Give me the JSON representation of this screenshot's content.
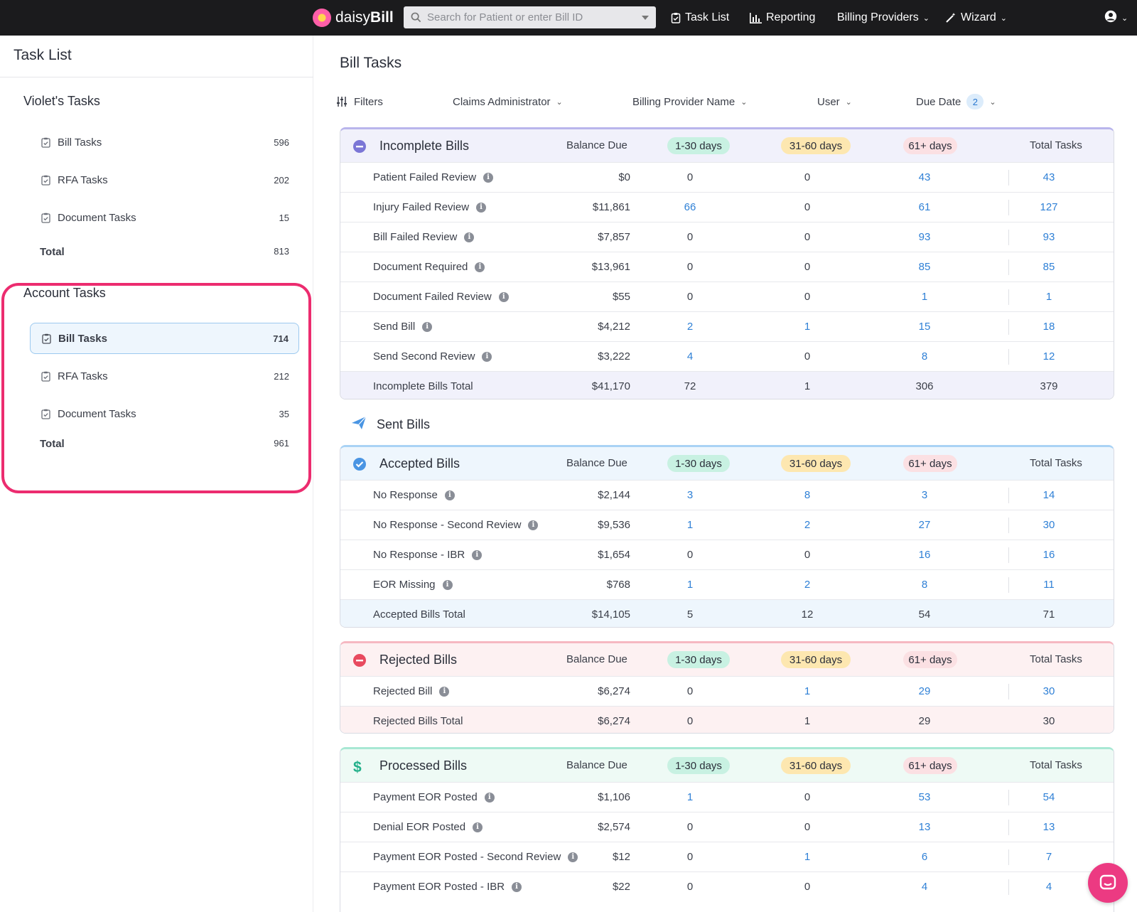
{
  "topbar": {
    "logo_daisy": "daisy",
    "logo_bill": "Bill",
    "search_placeholder": "Search for Patient or enter Bill ID",
    "nav": {
      "task_list": "Task List",
      "reporting": "Reporting",
      "billing_providers": "Billing Providers",
      "wizard": "Wizard"
    }
  },
  "sidebar": {
    "title": "Task List",
    "violet": {
      "title": "Violet's Tasks",
      "items": [
        {
          "label": "Bill Tasks",
          "count": "596"
        },
        {
          "label": "RFA Tasks",
          "count": "202"
        },
        {
          "label": "Document Tasks",
          "count": "15"
        }
      ],
      "total_label": "Total",
      "total_count": "813"
    },
    "account": {
      "title": "Account Tasks",
      "items": [
        {
          "label": "Bill Tasks",
          "count": "714"
        },
        {
          "label": "RFA Tasks",
          "count": "212"
        },
        {
          "label": "Document Tasks",
          "count": "35"
        }
      ],
      "total_label": "Total",
      "total_count": "961"
    }
  },
  "main": {
    "title": "Bill Tasks",
    "filters": {
      "label": "Filters",
      "claims_admin": "Claims Administrator",
      "billing_provider": "Billing Provider Name",
      "user": "User",
      "due_date": "Due Date",
      "due_date_count": "2"
    },
    "columns": {
      "balance": "Balance Due",
      "d1": "1-30 days",
      "d2": "31-60 days",
      "d3": "61+ days",
      "total": "Total Tasks"
    },
    "sent_bills_label": "Sent Bills",
    "sections": {
      "incomplete": {
        "title": "Incomplete Bills",
        "rows": [
          {
            "label": "Patient Failed Review",
            "balance": "$0",
            "d1": "0",
            "d2": "0",
            "d3": "43",
            "total": "43"
          },
          {
            "label": "Injury Failed Review",
            "balance": "$11,861",
            "d1": "66",
            "d2": "0",
            "d3": "61",
            "total": "127"
          },
          {
            "label": "Bill Failed Review",
            "balance": "$7,857",
            "d1": "0",
            "d2": "0",
            "d3": "93",
            "total": "93"
          },
          {
            "label": "Document Required",
            "balance": "$13,961",
            "d1": "0",
            "d2": "0",
            "d3": "85",
            "total": "85"
          },
          {
            "label": "Document Failed Review",
            "balance": "$55",
            "d1": "0",
            "d2": "0",
            "d3": "1",
            "total": "1"
          },
          {
            "label": "Send Bill",
            "balance": "$4,212",
            "d1": "2",
            "d2": "1",
            "d3": "15",
            "total": "18"
          },
          {
            "label": "Send Second Review",
            "balance": "$3,222",
            "d1": "4",
            "d2": "0",
            "d3": "8",
            "total": "12"
          }
        ],
        "total": {
          "label": "Incomplete Bills Total",
          "balance": "$41,170",
          "d1": "72",
          "d2": "1",
          "d3": "306",
          "total": "379"
        }
      },
      "accepted": {
        "title": "Accepted Bills",
        "rows": [
          {
            "label": "No Response",
            "balance": "$2,144",
            "d1": "3",
            "d2": "8",
            "d3": "3",
            "total": "14"
          },
          {
            "label": "No Response - Second Review",
            "balance": "$9,536",
            "d1": "1",
            "d2": "2",
            "d3": "27",
            "total": "30"
          },
          {
            "label": "No Response - IBR",
            "balance": "$1,654",
            "d1": "0",
            "d2": "0",
            "d3": "16",
            "total": "16"
          },
          {
            "label": "EOR Missing",
            "balance": "$768",
            "d1": "1",
            "d2": "2",
            "d3": "8",
            "total": "11"
          }
        ],
        "total": {
          "label": "Accepted Bills Total",
          "balance": "$14,105",
          "d1": "5",
          "d2": "12",
          "d3": "54",
          "total": "71"
        }
      },
      "rejected": {
        "title": "Rejected Bills",
        "rows": [
          {
            "label": "Rejected Bill",
            "balance": "$6,274",
            "d1": "0",
            "d2": "1",
            "d3": "29",
            "total": "30"
          }
        ],
        "total": {
          "label": "Rejected Bills Total",
          "balance": "$6,274",
          "d1": "0",
          "d2": "1",
          "d3": "29",
          "total": "30"
        }
      },
      "processed": {
        "title": "Processed Bills",
        "rows": [
          {
            "label": "Payment EOR Posted",
            "balance": "$1,106",
            "d1": "1",
            "d2": "0",
            "d3": "53",
            "total": "54"
          },
          {
            "label": "Denial EOR Posted",
            "balance": "$2,574",
            "d1": "0",
            "d2": "0",
            "d3": "13",
            "total": "13"
          },
          {
            "label": "Payment EOR Posted - Second Review",
            "balance": "$12",
            "d1": "0",
            "d2": "1",
            "d3": "6",
            "total": "7"
          },
          {
            "label": "Payment EOR Posted - IBR",
            "balance": "$22",
            "d1": "0",
            "d2": "0",
            "d3": "4",
            "total": "4"
          }
        ]
      }
    }
  },
  "colors": {
    "topbar_bg": "#1b1b1d",
    "highlight": "#ec2c6f",
    "link": "#2f80d6",
    "incomplete_accent": "#7b76d6",
    "accepted_accent": "#4a95e3",
    "rejected_accent": "#e84a5f",
    "processed_accent": "#23b08a",
    "chat_button": "#ec3a82"
  }
}
